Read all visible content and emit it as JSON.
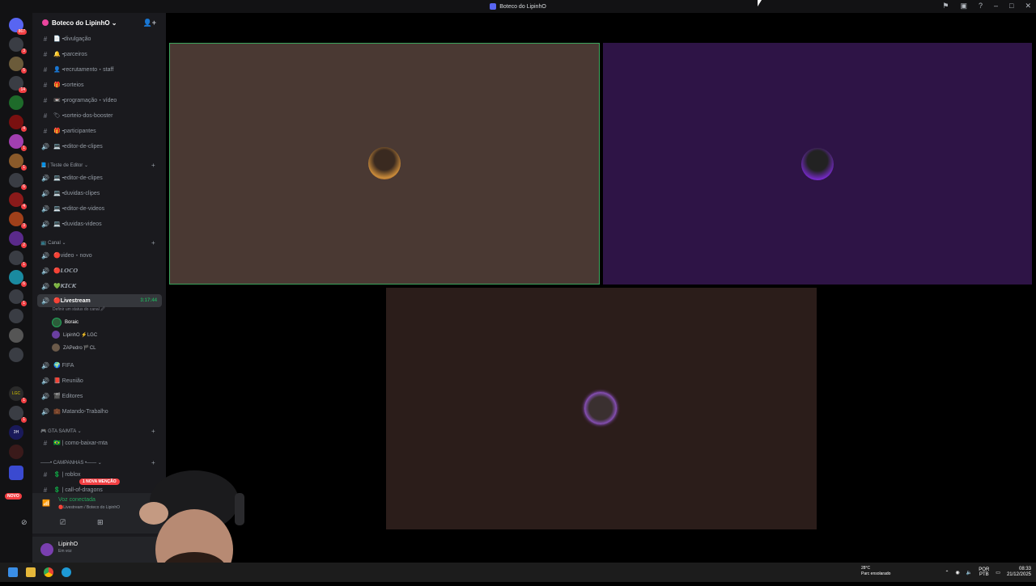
{
  "window": {
    "title": "Boteco do LipinhO"
  },
  "server": {
    "name": "Boteco do LipinhO",
    "badges": [
      "867",
      "3",
      "5",
      "14",
      "4",
      "1",
      "1",
      "6",
      "4",
      "3",
      "2",
      "1",
      "6",
      "1",
      "1",
      "1",
      "1",
      "1"
    ],
    "server_labels": [
      "LGC",
      "3H"
    ],
    "novo_label": "NOVO"
  },
  "channels": [
    {
      "icon": "#",
      "name": "📄╺divulgação"
    },
    {
      "icon": "#",
      "name": "🔔╺parceiros"
    },
    {
      "icon": "#",
      "name": "👤╺recrutamento・staff"
    },
    {
      "icon": "#",
      "name": "🎁╺sorteios"
    },
    {
      "icon": "#",
      "name": "📼╺programação・vídeo"
    },
    {
      "icon": "#",
      "name": "🏷╺sorteio-dos-booster"
    },
    {
      "icon": "#",
      "name": "🎁╺participantes"
    },
    {
      "icon": "🔊",
      "name": "💻╺editor-de-clipes"
    }
  ],
  "category_teste": "📘 | Teste de Editor ⌄",
  "teste_channels": [
    {
      "icon": "🔊",
      "name": "💻╺editor-de-clipes"
    },
    {
      "icon": "🔊",
      "name": "💻╺duvidas-clipes"
    },
    {
      "icon": "🔊",
      "name": "💻╺editor-de-videos"
    },
    {
      "icon": "🔊",
      "name": "💻╺duvidas-videos"
    }
  ],
  "category_canal": "📺 Canal ⌄",
  "canal_channels": [
    {
      "icon": "🔊",
      "name": "🔴video・novo"
    },
    {
      "icon": "🔊",
      "name": "🔴𝙇𝙊𝘾𝙊"
    },
    {
      "icon": "🔊",
      "name": "💚𝙆𝙄𝘾𝙆"
    }
  ],
  "active_channel": {
    "name": "🔴Livestream",
    "timer": "3:17:44",
    "status_hint": "Definir um status do canal 🖉",
    "users": [
      "Boraic",
      "LipinhO ⚡LGC",
      "ZAPedro 🏴CL"
    ]
  },
  "more_channels": [
    {
      "icon": "🔊",
      "name": "🌍 FIFA"
    },
    {
      "icon": "🔊",
      "name": "📕 Reunião"
    },
    {
      "icon": "🔊",
      "name": "🎬 Editores"
    },
    {
      "icon": "🔊",
      "name": "💼 Matando-Trabalho"
    }
  ],
  "category_gta": "🎮 GTA SA/MTA ⌄",
  "gta_channels": [
    {
      "icon": "#",
      "name": "🇧🇷 | como-baixar-mta"
    }
  ],
  "category_campanhas": "——• CAMPANHAS •—— ⌄",
  "campanhas_channels": [
    {
      "icon": "#",
      "name": "💲 | roblox"
    },
    {
      "icon": "#",
      "name": "💲 | call-of-dragons"
    }
  ],
  "mention_label": "1 NOVA MENÇÃO",
  "voice_panel": {
    "status": "Voz conectada",
    "sub": "🔴Livestream / Boteco do LipinhO"
  },
  "user_panel": {
    "name": "LipinhO",
    "status": "Em voz"
  },
  "tiles": [
    {
      "bg": "#4a3933",
      "border": "#3ba55c"
    },
    {
      "bg": "#2e1446",
      "border": "none"
    },
    {
      "bg": "#2b1d1a",
      "border": "none"
    }
  ],
  "taskbar": {
    "weather_temp": "28°C",
    "weather_desc": "Parc ensolarado",
    "lang": "POR",
    "lang2": "PTB",
    "time": "08:33",
    "date": "21/12/2025"
  },
  "icons": [
    "discord-logo-icon",
    "add-member-icon",
    "hash-icon",
    "speaker-icon",
    "plus-icon",
    "signal-icon",
    "camera-off-icon",
    "screen-share-icon",
    "activity-icon",
    "inbox-icon",
    "help-icon",
    "minimize-icon",
    "maximize-icon",
    "close-icon",
    "windows-start-icon",
    "file-explorer-icon",
    "chrome-icon",
    "edge-icon"
  ]
}
